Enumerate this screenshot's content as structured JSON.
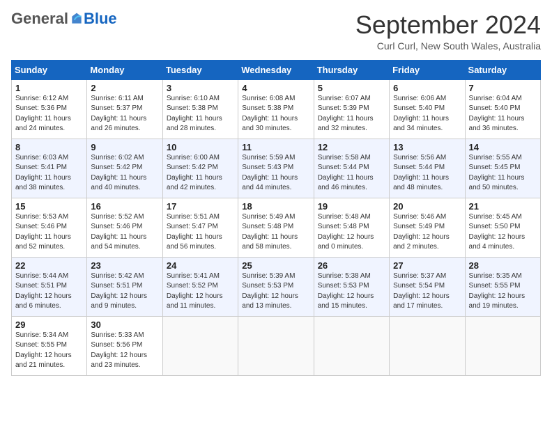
{
  "logo": {
    "general": "General",
    "blue": "Blue"
  },
  "title": "September 2024",
  "location": "Curl Curl, New South Wales, Australia",
  "weekdays": [
    "Sunday",
    "Monday",
    "Tuesday",
    "Wednesday",
    "Thursday",
    "Friday",
    "Saturday"
  ],
  "weeks": [
    [
      {
        "day": 1,
        "sunrise": "6:12 AM",
        "sunset": "5:36 PM",
        "daylight": "11 hours and 24 minutes."
      },
      {
        "day": 2,
        "sunrise": "6:11 AM",
        "sunset": "5:37 PM",
        "daylight": "11 hours and 26 minutes."
      },
      {
        "day": 3,
        "sunrise": "6:10 AM",
        "sunset": "5:38 PM",
        "daylight": "11 hours and 28 minutes."
      },
      {
        "day": 4,
        "sunrise": "6:08 AM",
        "sunset": "5:38 PM",
        "daylight": "11 hours and 30 minutes."
      },
      {
        "day": 5,
        "sunrise": "6:07 AM",
        "sunset": "5:39 PM",
        "daylight": "11 hours and 32 minutes."
      },
      {
        "day": 6,
        "sunrise": "6:06 AM",
        "sunset": "5:40 PM",
        "daylight": "11 hours and 34 minutes."
      },
      {
        "day": 7,
        "sunrise": "6:04 AM",
        "sunset": "5:40 PM",
        "daylight": "11 hours and 36 minutes."
      }
    ],
    [
      {
        "day": 8,
        "sunrise": "6:03 AM",
        "sunset": "5:41 PM",
        "daylight": "11 hours and 38 minutes."
      },
      {
        "day": 9,
        "sunrise": "6:02 AM",
        "sunset": "5:42 PM",
        "daylight": "11 hours and 40 minutes."
      },
      {
        "day": 10,
        "sunrise": "6:00 AM",
        "sunset": "5:42 PM",
        "daylight": "11 hours and 42 minutes."
      },
      {
        "day": 11,
        "sunrise": "5:59 AM",
        "sunset": "5:43 PM",
        "daylight": "11 hours and 44 minutes."
      },
      {
        "day": 12,
        "sunrise": "5:58 AM",
        "sunset": "5:44 PM",
        "daylight": "11 hours and 46 minutes."
      },
      {
        "day": 13,
        "sunrise": "5:56 AM",
        "sunset": "5:44 PM",
        "daylight": "11 hours and 48 minutes."
      },
      {
        "day": 14,
        "sunrise": "5:55 AM",
        "sunset": "5:45 PM",
        "daylight": "11 hours and 50 minutes."
      }
    ],
    [
      {
        "day": 15,
        "sunrise": "5:53 AM",
        "sunset": "5:46 PM",
        "daylight": "11 hours and 52 minutes."
      },
      {
        "day": 16,
        "sunrise": "5:52 AM",
        "sunset": "5:46 PM",
        "daylight": "11 hours and 54 minutes."
      },
      {
        "day": 17,
        "sunrise": "5:51 AM",
        "sunset": "5:47 PM",
        "daylight": "11 hours and 56 minutes."
      },
      {
        "day": 18,
        "sunrise": "5:49 AM",
        "sunset": "5:48 PM",
        "daylight": "11 hours and 58 minutes."
      },
      {
        "day": 19,
        "sunrise": "5:48 AM",
        "sunset": "5:48 PM",
        "daylight": "12 hours and 0 minutes."
      },
      {
        "day": 20,
        "sunrise": "5:46 AM",
        "sunset": "5:49 PM",
        "daylight": "12 hours and 2 minutes."
      },
      {
        "day": 21,
        "sunrise": "5:45 AM",
        "sunset": "5:50 PM",
        "daylight": "12 hours and 4 minutes."
      }
    ],
    [
      {
        "day": 22,
        "sunrise": "5:44 AM",
        "sunset": "5:51 PM",
        "daylight": "12 hours and 6 minutes."
      },
      {
        "day": 23,
        "sunrise": "5:42 AM",
        "sunset": "5:51 PM",
        "daylight": "12 hours and 9 minutes."
      },
      {
        "day": 24,
        "sunrise": "5:41 AM",
        "sunset": "5:52 PM",
        "daylight": "12 hours and 11 minutes."
      },
      {
        "day": 25,
        "sunrise": "5:39 AM",
        "sunset": "5:53 PM",
        "daylight": "12 hours and 13 minutes."
      },
      {
        "day": 26,
        "sunrise": "5:38 AM",
        "sunset": "5:53 PM",
        "daylight": "12 hours and 15 minutes."
      },
      {
        "day": 27,
        "sunrise": "5:37 AM",
        "sunset": "5:54 PM",
        "daylight": "12 hours and 17 minutes."
      },
      {
        "day": 28,
        "sunrise": "5:35 AM",
        "sunset": "5:55 PM",
        "daylight": "12 hours and 19 minutes."
      }
    ],
    [
      {
        "day": 29,
        "sunrise": "5:34 AM",
        "sunset": "5:55 PM",
        "daylight": "12 hours and 21 minutes."
      },
      {
        "day": 30,
        "sunrise": "5:33 AM",
        "sunset": "5:56 PM",
        "daylight": "12 hours and 23 minutes."
      },
      null,
      null,
      null,
      null,
      null
    ]
  ]
}
